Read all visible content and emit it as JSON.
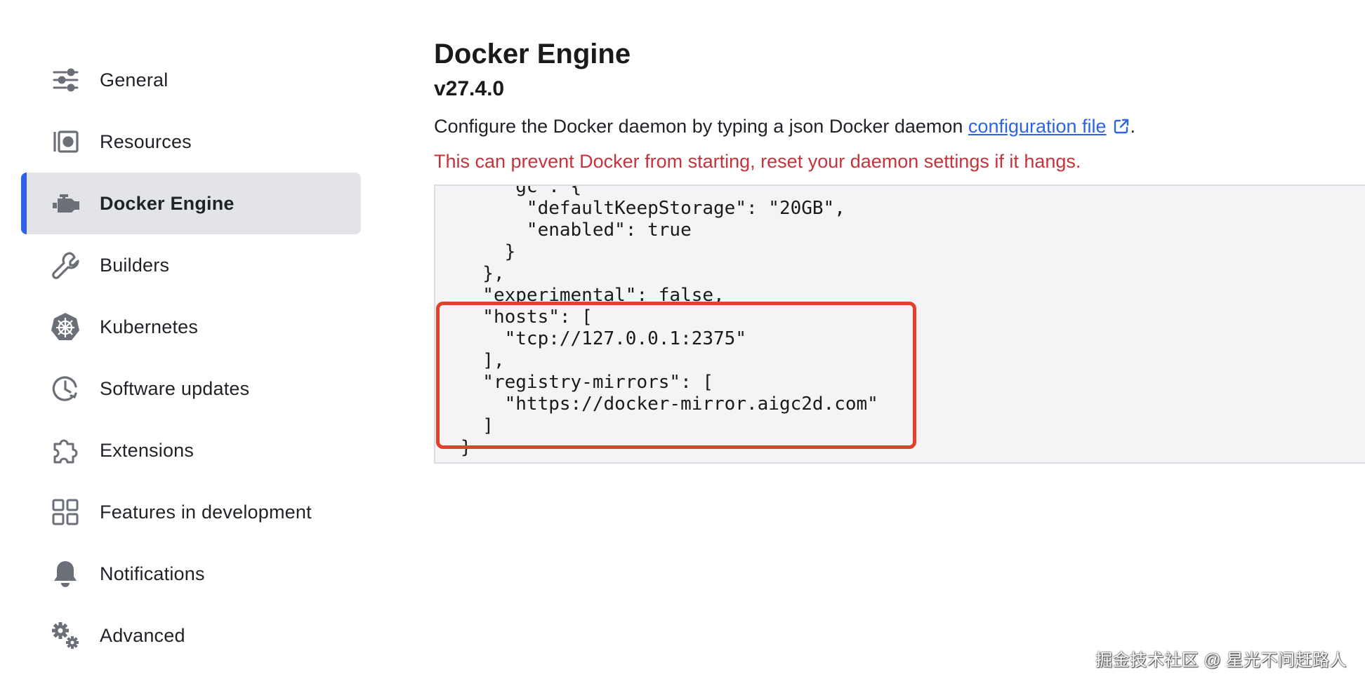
{
  "sidebar": {
    "items": [
      {
        "label": "General",
        "icon": "sliders-icon"
      },
      {
        "label": "Resources",
        "icon": "resources-icon"
      },
      {
        "label": "Docker Engine",
        "icon": "engine-icon",
        "active": true
      },
      {
        "label": "Builders",
        "icon": "wrench-icon"
      },
      {
        "label": "Kubernetes",
        "icon": "kubernetes-helm-icon"
      },
      {
        "label": "Software updates",
        "icon": "clock-update-icon"
      },
      {
        "label": "Extensions",
        "icon": "puzzle-icon"
      },
      {
        "label": "Features in development",
        "icon": "grid-icon"
      },
      {
        "label": "Notifications",
        "icon": "bell-icon"
      },
      {
        "label": "Advanced",
        "icon": "gears-icon"
      }
    ]
  },
  "main": {
    "title": "Docker Engine",
    "version": "v27.4.0",
    "description_prefix": "Configure the Docker daemon by typing a json Docker daemon ",
    "description_link": "configuration file",
    "description_suffix": ".",
    "warning": "This can prevent Docker from starting, reset your daemon settings if it hangs."
  },
  "editor": {
    "lines": [
      "    \"gc\": {",
      "      \"defaultKeepStorage\": \"20GB\",",
      "      \"enabled\": true",
      "    }",
      "  },",
      "  \"experimental\": false,",
      "  \"hosts\": [",
      "    \"tcp://127.0.0.1:2375\"",
      "  ],",
      "  \"registry-mirrors\": [",
      "    \"https://docker-mirror.aigc2d.com\"",
      "  ]",
      "}"
    ]
  },
  "watermark": "掘金技术社区 @ 星光不问赶路人",
  "colors": {
    "accent": "#2e63e6",
    "warning": "#c8323a",
    "highlight": "#e3402a",
    "active_bg": "#e3e4e8",
    "icon": "#6b6f78"
  }
}
